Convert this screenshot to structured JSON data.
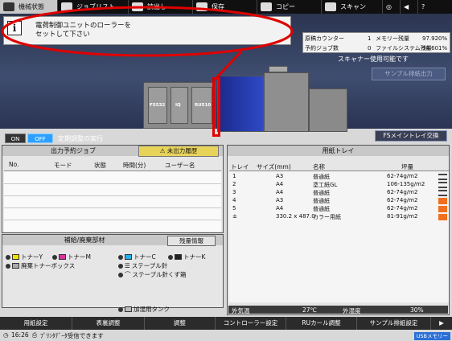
{
  "topbar": {
    "tabs": [
      {
        "label": "機械状態",
        "active": true
      },
      {
        "label": "ジョブリスト",
        "active": false
      },
      {
        "label": "読出し",
        "active": false
      },
      {
        "label": "保存",
        "active": false
      },
      {
        "label": "コピー",
        "active": false
      },
      {
        "label": "スキャン",
        "active": false
      }
    ]
  },
  "message": {
    "line1": "電荷制御ユニットのローラーを",
    "line2": "セットして下さい"
  },
  "counters": {
    "original_label": "原稿カウンター",
    "original_value": "1",
    "memory_label": "メモリー残量",
    "memory_value": "97.920%",
    "reserved_label": "予約ジョブ数",
    "reserved_value": "0",
    "filesystem_label": "ファイルシステム残量",
    "filesystem_value": "98.601%"
  },
  "scanner_status": "スキャナー使用可能です",
  "sample_output_button": "サンプル排紙出力",
  "machine": {
    "units": [
      "FS532",
      "IQ",
      "RU510"
    ]
  },
  "adjust": {
    "on_label": "ON",
    "off_label": "OFF",
    "label": "定期調整の実行"
  },
  "fs_maintenance_button": "FSメイントレイ交換",
  "output_jobs": {
    "title": "出力予約ジョブ",
    "unsent_button": "未出力履歴",
    "columns": [
      "No.",
      "モード",
      "状態",
      "時間(分)",
      "ユーザー名"
    ]
  },
  "supplies": {
    "title": "補給/廃棄部材",
    "stock_button": "残量情報",
    "items": [
      {
        "label": "トナーY",
        "icon": "toner-y"
      },
      {
        "label": "トナーM",
        "icon": "toner-m"
      },
      {
        "label": "トナーC",
        "icon": "toner-c"
      },
      {
        "label": "トナーK",
        "icon": "toner-k"
      },
      {
        "label": "廃棄トナーボックス",
        "icon": "waste-box"
      },
      {
        "label": "ステープル針",
        "icon": "staple"
      },
      {
        "label": "ステープル針くず箱",
        "icon": "staple-waste"
      },
      {
        "label": "加湿用タンク",
        "icon": "tank"
      }
    ]
  },
  "paper_tray": {
    "title": "用紙トレイ",
    "columns": [
      "トレイ",
      "サイズ(mm)",
      "名称",
      "坪量"
    ],
    "rows": [
      {
        "tray": "1",
        "size": "A3",
        "name": "普通紙",
        "weight": "62-74g/m2",
        "level": "full"
      },
      {
        "tray": "2",
        "size": "A4",
        "name": "塗工紙GL",
        "weight": "106-135g/m2",
        "level": "full"
      },
      {
        "tray": "3",
        "size": "A4",
        "name": "普通紙",
        "weight": "62-74g/m2",
        "level": "full"
      },
      {
        "tray": "4",
        "size": "A3",
        "name": "普通紙",
        "weight": "62-74g/m2",
        "level": "low"
      },
      {
        "tray": "5",
        "size": "A4",
        "name": "普通紙",
        "weight": "62-74g/m2",
        "level": "low"
      },
      {
        "tray": "±",
        "size": "330.2 x 487.0",
        "name": "カラー用紙",
        "weight": "81-91g/m2",
        "level": "low"
      }
    ],
    "env_temp_label": "外気温",
    "env_temp_value": "27℃",
    "env_hum_label": "外湿度",
    "env_hum_value": "30%"
  },
  "bottom_buttons": [
    "用紙設定",
    "表裏調整",
    "調整",
    "コントローラー設定",
    "RUカール調整",
    "サンプル排紙設定"
  ],
  "status": {
    "time": "16:26",
    "receiving": "ﾌﾟﾘﾝﾀﾃﾞｰﾀ受信できます",
    "usb": "USBメモリー"
  },
  "colors": {
    "accent": "#2da0ff",
    "alert": "#e00000",
    "warn": "#e8d35a",
    "low_indicator": "#f07020"
  }
}
